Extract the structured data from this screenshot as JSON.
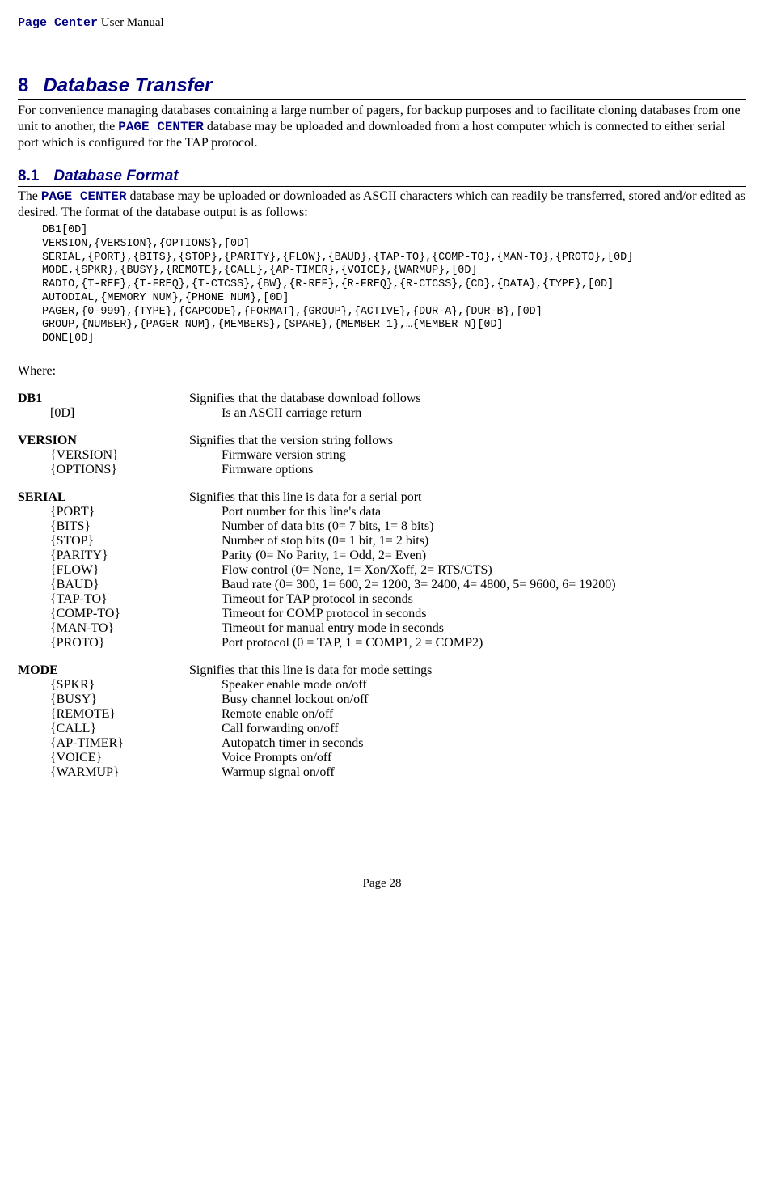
{
  "header": {
    "product": "Page Center",
    "suffix": " User Manual"
  },
  "section": {
    "num": "8",
    "title": "Database Transfer",
    "para_before": "For convenience managing databases containing a large number of pagers, for backup purposes and to facilitate cloning databases from one unit to another, the ",
    "para_inline": "PAGE CENTER",
    "para_after": " database may be uploaded and downloaded from a host computer which is connected to either serial port which is configured for the TAP protocol."
  },
  "subsection": {
    "num": "8.1",
    "title": "Database Format",
    "para_before": "The ",
    "para_inline": "PAGE CENTER",
    "para_after": " database may be uploaded or downloaded as ASCII characters which can readily be transferred, stored and/or edited as desired.  The format of the database output is as follows:"
  },
  "code": "DB1[0D]\nVERSION,{VERSION},{OPTIONS},[0D]\nSERIAL,{PORT},{BITS},{STOP},{PARITY},{FLOW},{BAUD},{TAP-TO},{COMP-TO},{MAN-TO},{PROTO},[0D]\nMODE,{SPKR},{BUSY},{REMOTE},{CALL},{AP-TIMER},{VOICE},{WARMUP},[0D]\nRADIO,{T-REF},{T-FREQ},{T-CTCSS},{BW},{R-REF},{R-FREQ},{R-CTCSS},{CD},{DATA},{TYPE},[0D]\nAUTODIAL,{MEMORY NUM},{PHONE NUM},[0D]\nPAGER,{0-999},{TYPE},{CAPCODE},{FORMAT},{GROUP},{ACTIVE},{DUR-A},{DUR-B},[0D]\nGROUP,{NUMBER},{PAGER NUM},{MEMBERS},{SPARE},{MEMBER 1},…{MEMBER N}[0D]\nDONE[0D]",
  "where_label": "Where:",
  "defs": {
    "db1": {
      "term": "DB1",
      "def": "Signifies that the database download follows"
    },
    "d0": {
      "term": "[0D]",
      "def": "Is an ASCII carriage return"
    },
    "version_h": {
      "term": "VERSION",
      "def": "Signifies that the version string follows"
    },
    "version": {
      "term": "{VERSION}",
      "def": "Firmware version string"
    },
    "options": {
      "term": "{OPTIONS}",
      "def": "Firmware options"
    },
    "serial_h": {
      "term": "SERIAL",
      "def": "Signifies that this line is data for a serial port"
    },
    "port": {
      "term": "{PORT}",
      "def": "Port number for this line's data"
    },
    "bits": {
      "term": "{BITS}",
      "def": "Number of data bits (0= 7 bits, 1= 8 bits)"
    },
    "stop": {
      "term": "{STOP}",
      "def": "Number of stop bits (0= 1 bit, 1= 2 bits)"
    },
    "parity": {
      "term": "{PARITY}",
      "def": "Parity (0= No Parity, 1= Odd, 2= Even)"
    },
    "flow": {
      "term": "{FLOW}",
      "def": "Flow control (0= None, 1= Xon/Xoff, 2= RTS/CTS)"
    },
    "baud": {
      "term": "{BAUD}",
      "def": "Baud rate (0= 300, 1= 600, 2= 1200, 3= 2400, 4= 4800, 5= 9600, 6= 19200)"
    },
    "tapto": {
      "term": "{TAP-TO}",
      "def": "Timeout for TAP protocol in seconds"
    },
    "compto": {
      "term": "{COMP-TO}",
      "def": "Timeout for COMP protocol in seconds"
    },
    "manto": {
      "term": "{MAN-TO}",
      "def": "Timeout for manual entry mode in seconds"
    },
    "proto": {
      "term": "{PROTO}",
      "def": "Port protocol (0 = TAP, 1 = COMP1, 2 = COMP2)"
    },
    "mode_h": {
      "term": "MODE",
      "def": "Signifies that this line is data for mode settings"
    },
    "spkr": {
      "term": "{SPKR}",
      "def": "Speaker enable mode on/off"
    },
    "busy": {
      "term": "{BUSY}",
      "def": "Busy channel lockout on/off"
    },
    "remote": {
      "term": "{REMOTE}",
      "def": "Remote enable on/off"
    },
    "call": {
      "term": "{CALL}",
      "def": "Call forwarding on/off"
    },
    "aptimer": {
      "term": "{AP-TIMER}",
      "def": "Autopatch timer in seconds"
    },
    "voice": {
      "term": "{VOICE}",
      "def": "Voice Prompts on/off"
    },
    "warmup": {
      "term": "{WARMUP}",
      "def": "Warmup signal on/off"
    }
  },
  "footer": "Page 28"
}
